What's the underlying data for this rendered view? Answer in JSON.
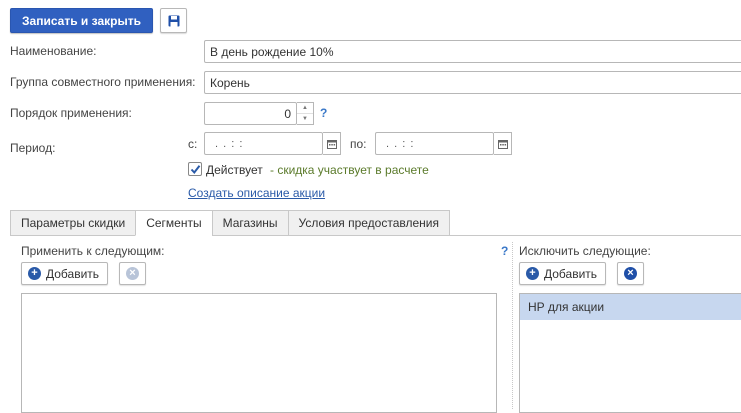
{
  "toolbar": {
    "save_close_label": "Записать и закрыть",
    "save_icon": "floppy-disk-icon"
  },
  "form": {
    "name_label": "Наименование:",
    "name_value": "В день рождение 10%",
    "group_label": "Группа совместного применения:",
    "group_value": "Корень",
    "order_label": "Порядок применения:",
    "order_value": "0",
    "help_mark": "?",
    "period_label": "Период:",
    "from_label": "с:",
    "from_value": ". .   : :",
    "to_label": "по:",
    "to_value": ". .   : :",
    "active_label": "Действует",
    "active_checked": true,
    "active_hint": "- скидка участвует в расчете",
    "create_link": "Создать описание акции"
  },
  "tabs": [
    {
      "label": "Параметры скидки",
      "active": false
    },
    {
      "label": "Сегменты",
      "active": true
    },
    {
      "label": "Магазины",
      "active": false
    },
    {
      "label": "Условия предоставления",
      "active": false
    }
  ],
  "apply_panel": {
    "title": "Применить к следующим:",
    "help_mark": "?",
    "add_label": "Добавить"
  },
  "exclude_panel": {
    "title": "Исключить следующие:",
    "add_label": "Добавить",
    "items": [
      "НР для акции"
    ]
  },
  "colors": {
    "primary": "#3060c0",
    "selected_row": "#c7d7ef",
    "link": "#2a5aa8",
    "help": "#3a78c8"
  }
}
